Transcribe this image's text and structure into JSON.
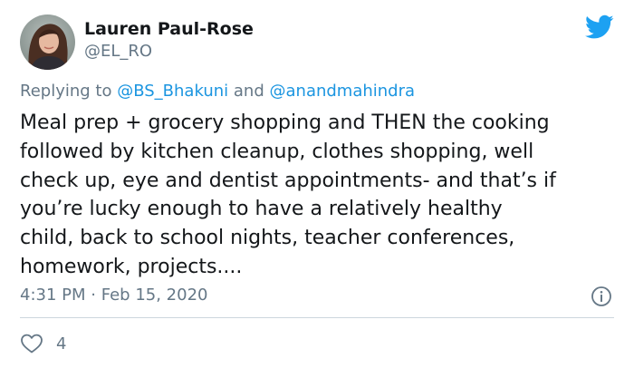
{
  "author": {
    "display_name": "Lauren Paul-Rose",
    "handle": "@EL_RO",
    "avatar_icon": "profile-photo"
  },
  "reply": {
    "prefix": "Replying to",
    "mention_1": "@BS_Bhakuni",
    "conjunction": "and",
    "mention_2": "@anandmahindra"
  },
  "tweet": {
    "lines": [
      "Meal prep + grocery shopping and THEN the cooking",
      "followed by kitchen cleanup, clothes shopping, well",
      "check up, eye and dentist appointments- and that’s if",
      "you’re lucky enough to have a relatively healthy",
      "child, back to school nights, teacher conferences,",
      "homework, projects...."
    ]
  },
  "meta": {
    "time": "4:31 PM",
    "separator": "·",
    "date": "Feb 15, 2020"
  },
  "engagement": {
    "likes": "4"
  },
  "colors": {
    "twitter_blue": "#1da1f2",
    "link_blue": "#1b95e0",
    "secondary_text": "#657786",
    "primary_text": "#14171a",
    "divider": "#ccd6dd"
  },
  "icons": {
    "brand": "twitter-bird-icon",
    "info": "info-icon",
    "like": "heart-icon"
  }
}
